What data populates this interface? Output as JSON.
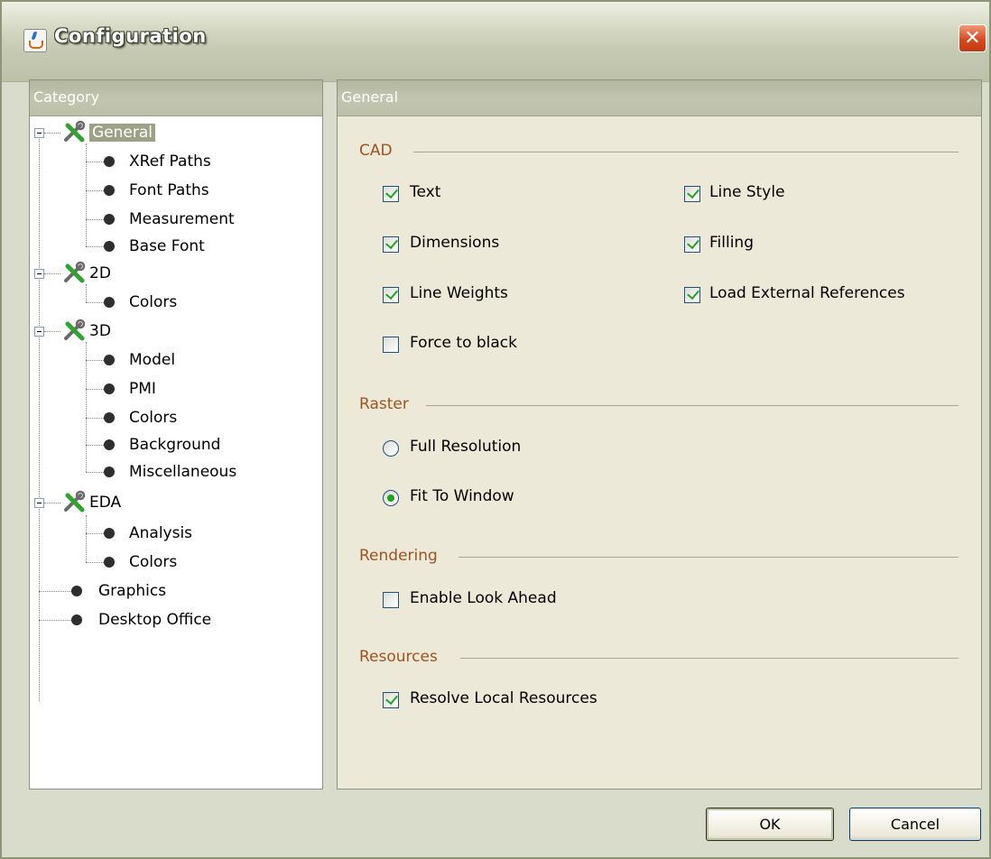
{
  "window": {
    "title": "Configuration",
    "close_glyph": "✕",
    "icon": "java-coffee-cup-icon"
  },
  "category_panel": {
    "header": "Category",
    "tree": {
      "general": {
        "label": "General",
        "children": [
          "XRef Paths",
          "Font Paths",
          "Measurement",
          "Base Font"
        ]
      },
      "d2": {
        "label": "2D",
        "children": [
          "Colors"
        ]
      },
      "d3": {
        "label": "3D",
        "children": [
          "Model",
          "PMI",
          "Colors",
          "Background",
          "Miscellaneous"
        ]
      },
      "eda": {
        "label": "EDA",
        "children": [
          "Analysis",
          "Colors"
        ]
      },
      "graphics": "Graphics",
      "desktop_office": "Desktop Office"
    },
    "selected": "General"
  },
  "settings_panel": {
    "header": "General",
    "cad": {
      "title": "CAD",
      "text": {
        "label": "Text",
        "checked": true
      },
      "line_style": {
        "label": "Line Style",
        "checked": true
      },
      "dimensions": {
        "label": "Dimensions",
        "checked": true
      },
      "filling": {
        "label": "Filling",
        "checked": true
      },
      "line_weights": {
        "label": "Line Weights",
        "checked": true
      },
      "load_external_references": {
        "label": "Load External References",
        "checked": true
      },
      "force_to_black": {
        "label": "Force to black",
        "checked": false
      }
    },
    "raster": {
      "title": "Raster",
      "full_resolution": {
        "label": "Full Resolution",
        "selected": false
      },
      "fit_to_window": {
        "label": "Fit To Window",
        "selected": true
      }
    },
    "rendering": {
      "title": "Rendering",
      "enable_look_ahead": {
        "label": "Enable Look Ahead",
        "checked": false
      }
    },
    "resources": {
      "title": "Resources",
      "resolve_local_resources": {
        "label": "Resolve Local Resources",
        "checked": true
      }
    }
  },
  "buttons": {
    "ok": "OK",
    "cancel": "Cancel"
  },
  "colors": {
    "title_bar": "#c6cab2",
    "panel_header": "#b7bba3",
    "group_title": "#a0521d",
    "check": "#21a121",
    "close": "#d8491f"
  }
}
